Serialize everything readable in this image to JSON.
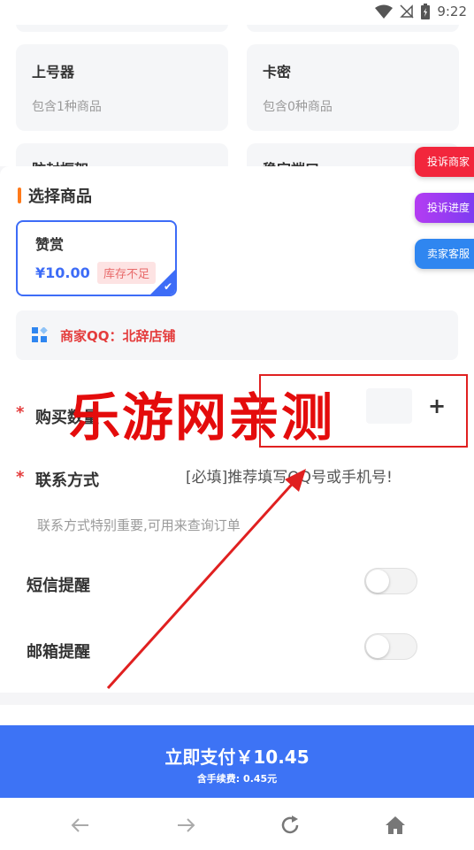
{
  "status_bar": {
    "time": "9:22"
  },
  "categories": [
    {
      "title": "上号器",
      "subtitle": "包含1种商品"
    },
    {
      "title": "卡密",
      "subtitle": "包含0种商品"
    },
    {
      "title": "防封框架"
    },
    {
      "title": "稳定端口"
    }
  ],
  "float_buttons": [
    {
      "label": "投诉商家",
      "color": "#f2263c"
    },
    {
      "label": "投诉进度",
      "color": "#9b3cf2"
    },
    {
      "label": "卖家客服",
      "color": "#2f86f0"
    }
  ],
  "section": {
    "title": "选择商品"
  },
  "product": {
    "name": "赞赏",
    "price": "¥10.00",
    "badge": "库存不足"
  },
  "shop": {
    "label": "商家QQ：北辞店铺"
  },
  "form": {
    "quantity_label": "购买数量",
    "quantity_plus": "+",
    "contact_label": "联系方式",
    "contact_placeholder": "[必填]推荐填写QQ号或手机号!",
    "contact_hint": "联系方式特别重要,可用来查询订单",
    "sms_label": "短信提醒",
    "email_label": "邮箱提醒"
  },
  "watermark": {
    "text": "乐游网亲测"
  },
  "pay": {
    "label": "立即支付￥10.45",
    "fee": "含手续费: 0.45元"
  },
  "colors": {
    "accent": "#3d73f5",
    "orange": "#ff7a1a",
    "red": "#e43c3c"
  }
}
